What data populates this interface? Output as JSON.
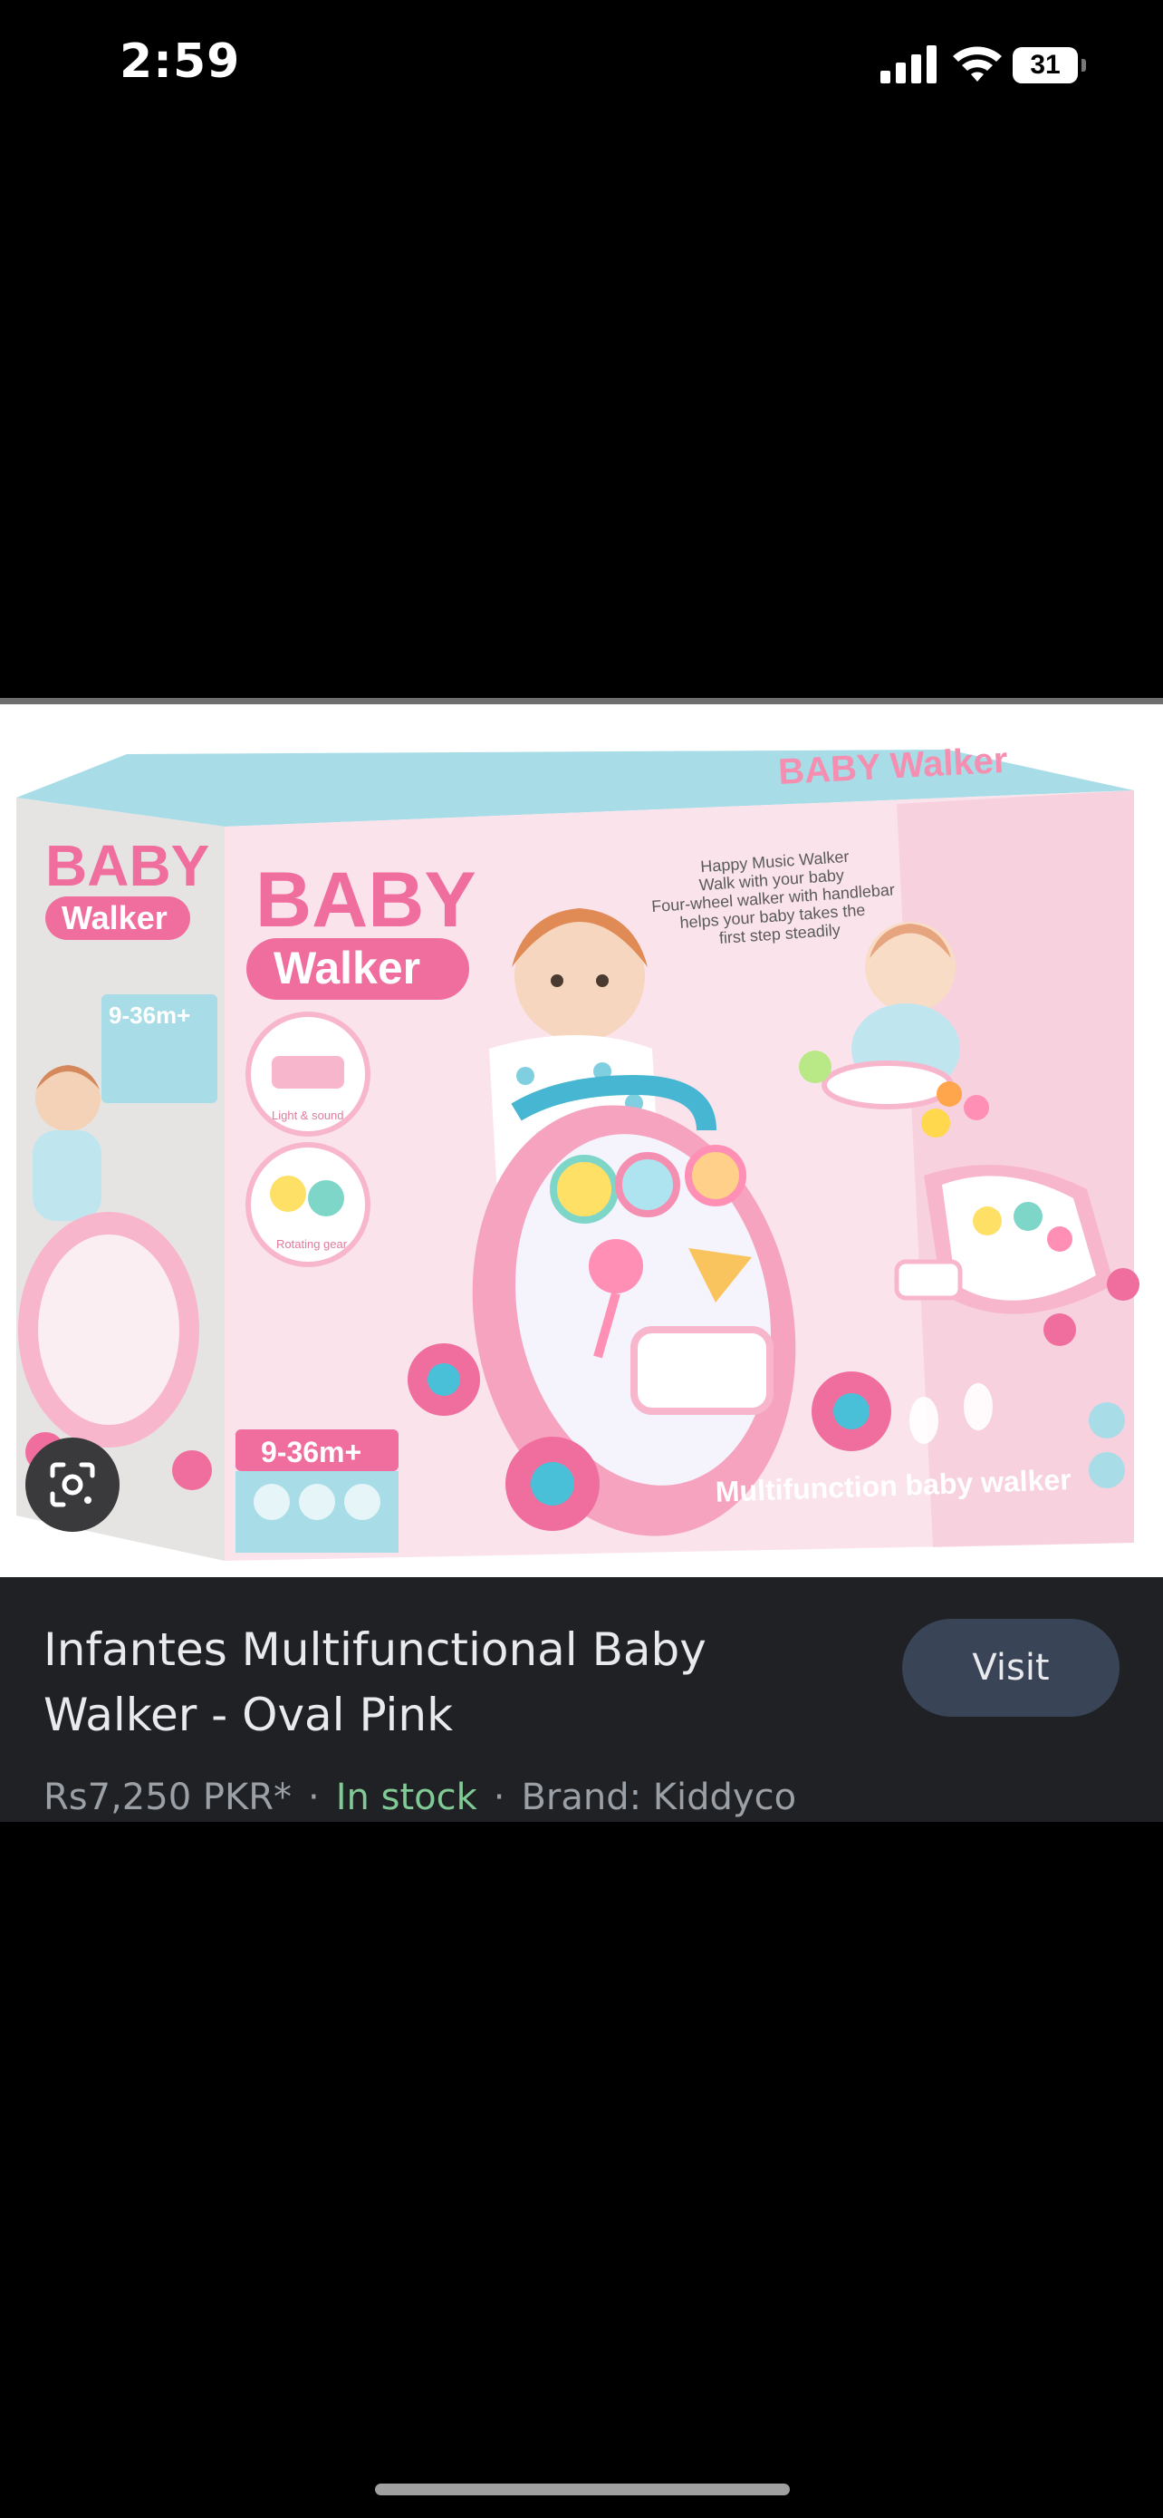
{
  "status_bar": {
    "time": "2:59",
    "battery": "31"
  },
  "image": {
    "box_top_text": "BABY Walker",
    "brand_small": "BABY",
    "brand_small_sub": "Walker",
    "brand_main": "BABY",
    "brand_main_sub": "Walker",
    "age_side": "9-36m+",
    "age_front": "9-36m+",
    "blurb": [
      "Happy Music Walker",
      "Walk with your baby",
      "Four-wheel walker with handlebar",
      "helps your baby  takes the",
      "first step steadily"
    ],
    "tagline": "Multifunction baby walker",
    "feature_1": "Light & sound",
    "feature_2": "Rotating gear"
  },
  "product": {
    "title": "Infantes Multifunctional Baby Walker - Oval Pink",
    "price": "Rs7,250 PKR*",
    "stock": "In stock",
    "brand": "Brand: Kiddyco"
  },
  "actions": {
    "visit_label": "Visit"
  },
  "colors": {
    "card_bg": "#202124",
    "visit_bg": "#394457",
    "stock_green": "#81c995",
    "pink": "#f06e9e",
    "teal": "#9fd8e4"
  }
}
